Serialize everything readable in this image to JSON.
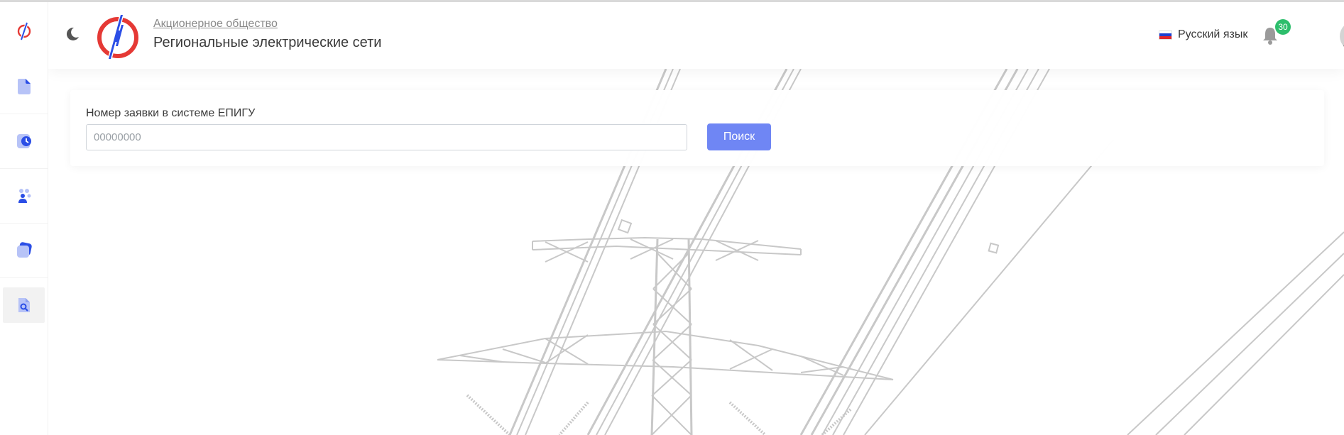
{
  "header": {
    "org_type": "Акционерное общество",
    "org_name": "Региональные электрические сети",
    "language": "Русский язык",
    "notification_count": "30"
  },
  "search": {
    "label": "Номер заявки в системе ЕПИГУ",
    "placeholder": "00000000",
    "button_label": "Поиск"
  },
  "sidebar": {
    "items": [
      {
        "icon": "document-icon"
      },
      {
        "icon": "document-clock-icon"
      },
      {
        "icon": "people-icon"
      },
      {
        "icon": "cards-icon"
      },
      {
        "icon": "document-search-icon",
        "active": true
      }
    ]
  },
  "colors": {
    "accent": "#6f86f4",
    "icon_blue": "#2b4ee6",
    "icon_light": "#b7c3f7",
    "logo_red": "#e53935",
    "logo_blue": "#2b4ee6",
    "badge_green": "#2dbe6c"
  }
}
